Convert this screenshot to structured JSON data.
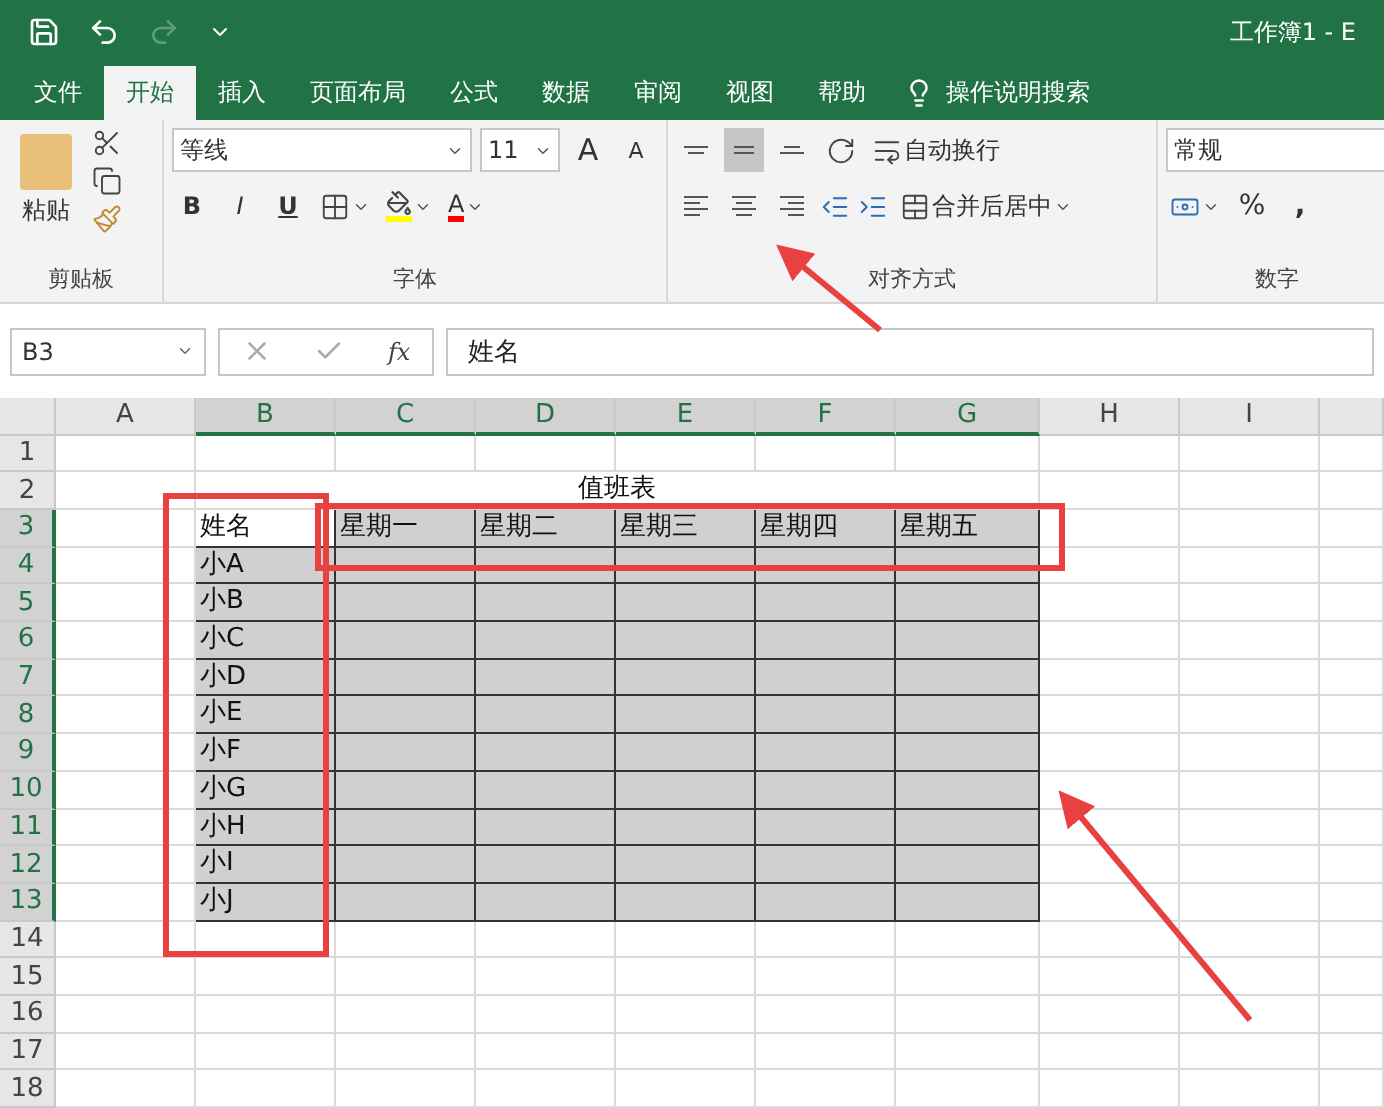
{
  "window": {
    "title": "工作簿1 - E"
  },
  "tabs": [
    {
      "label": "文件",
      "selected": false
    },
    {
      "label": "开始",
      "selected": true
    },
    {
      "label": "插入",
      "selected": false
    },
    {
      "label": "页面布局",
      "selected": false
    },
    {
      "label": "公式",
      "selected": false
    },
    {
      "label": "数据",
      "selected": false
    },
    {
      "label": "审阅",
      "selected": false
    },
    {
      "label": "视图",
      "selected": false
    },
    {
      "label": "帮助",
      "selected": false
    }
  ],
  "tell_me": "操作说明搜索",
  "ribbon": {
    "clipboard": {
      "paste": "粘贴",
      "label": "剪贴板"
    },
    "font": {
      "name": "等线",
      "size": "11",
      "grow": "A",
      "shrink": "A",
      "bold": "B",
      "italic": "I",
      "underline": "U",
      "font_color": "A",
      "label": "字体"
    },
    "alignment": {
      "vertical": [
        {
          "kind": "top",
          "selected": false
        },
        {
          "kind": "middle",
          "selected": true
        },
        {
          "kind": "bottom",
          "selected": false
        }
      ],
      "horizontal": [
        {
          "kind": "left",
          "selected": false
        },
        {
          "kind": "center",
          "selected": false
        },
        {
          "kind": "right",
          "selected": false
        }
      ],
      "wrap": "自动换行",
      "merge": "合并后居中",
      "label": "对齐方式"
    },
    "number": {
      "format": "常规",
      "percent": "%",
      "comma": ",",
      "label": "数字"
    }
  },
  "formula_bar": {
    "name_box": "B3",
    "fx": "fx",
    "value": "姓名"
  },
  "sheet": {
    "columns": [
      {
        "label": "A",
        "selected": false
      },
      {
        "label": "B",
        "selected": true
      },
      {
        "label": "C",
        "selected": true
      },
      {
        "label": "D",
        "selected": true
      },
      {
        "label": "E",
        "selected": true
      },
      {
        "label": "F",
        "selected": true
      },
      {
        "label": "G",
        "selected": true
      },
      {
        "label": "H",
        "selected": false
      },
      {
        "label": "I",
        "selected": false
      }
    ],
    "rows": [
      {
        "label": "1",
        "selected": false
      },
      {
        "label": "2",
        "selected": false
      },
      {
        "label": "3",
        "selected": true
      },
      {
        "label": "4",
        "selected": true
      },
      {
        "label": "5",
        "selected": true
      },
      {
        "label": "6",
        "selected": true
      },
      {
        "label": "7",
        "selected": true
      },
      {
        "label": "8",
        "selected": true
      },
      {
        "label": "9",
        "selected": true
      },
      {
        "label": "10",
        "selected": true
      },
      {
        "label": "11",
        "selected": true
      },
      {
        "label": "12",
        "selected": true
      },
      {
        "label": "13",
        "selected": true
      },
      {
        "label": "14",
        "selected": false
      },
      {
        "label": "15",
        "selected": false
      },
      {
        "label": "16",
        "selected": false
      },
      {
        "label": "17",
        "selected": false
      },
      {
        "label": "18",
        "selected": false
      }
    ],
    "title": "值班表",
    "header": [
      "姓名",
      "星期一",
      "星期二",
      "星期三",
      "星期四",
      "星期五"
    ],
    "names": [
      "小A",
      "小B",
      "小C",
      "小D",
      "小E",
      "小F",
      "小G",
      "小H",
      "小I",
      "小J"
    ]
  }
}
